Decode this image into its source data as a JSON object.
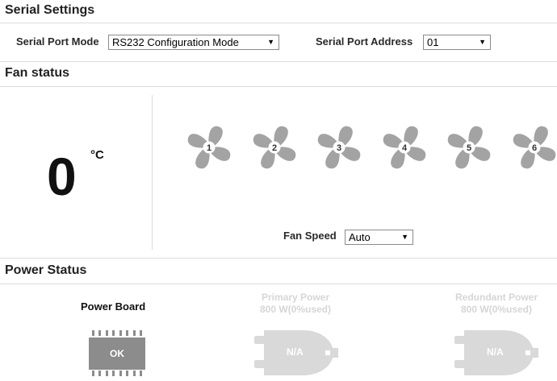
{
  "serial_settings": {
    "title": "Serial Settings",
    "port_mode_label": "Serial Port Mode",
    "port_mode_value": "RS232 Configuration Mode",
    "port_address_label": "Serial Port Address",
    "port_address_value": "01"
  },
  "fan_status": {
    "title": "Fan status",
    "temperature": "0",
    "temperature_unit": "°C",
    "fans": [
      {
        "number": "1",
        "icon": "fan-icon"
      },
      {
        "number": "2",
        "icon": "fan-icon"
      },
      {
        "number": "3",
        "icon": "fan-icon"
      },
      {
        "number": "4",
        "icon": "fan-icon"
      },
      {
        "number": "5",
        "icon": "fan-icon"
      },
      {
        "number": "6",
        "icon": "fan-icon"
      }
    ],
    "fan_speed_label": "Fan Speed",
    "fan_speed_value": "Auto"
  },
  "power_status": {
    "title": "Power Status",
    "power_board_label": "Power Board",
    "power_board_state": "OK",
    "primary_power_label": "Primary Power",
    "primary_power_capacity": "800 W(0%used)",
    "primary_power_state": "N/A",
    "redundant_power_label": "Redundant Power",
    "redundant_power_capacity": "800 W(0%used)",
    "redundant_power_state": "N/A"
  },
  "colors": {
    "fan_gray": "#a3a3a3",
    "chip_gray": "#8c8c8c",
    "inactive_gray": "#d9d9d9",
    "divider": "#dcdcdc"
  }
}
